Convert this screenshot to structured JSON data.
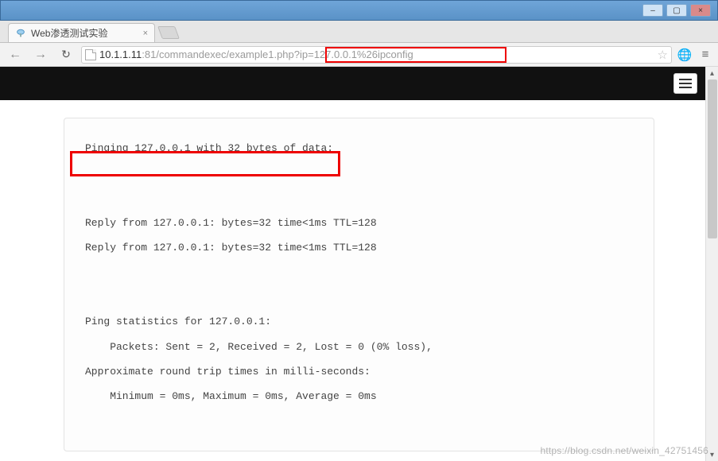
{
  "window": {
    "min_label": "–",
    "max_label": "▢",
    "close_label": "×"
  },
  "tab": {
    "title": "Web渗透测试实验",
    "close": "×"
  },
  "nav": {
    "back": "←",
    "forward": "→",
    "reload": "↻"
  },
  "url": {
    "host": "10.1.1.11",
    "rest": ":81/commandexec/example1.php?ip=127.0.0.1%26ipconfig",
    "star": "☆",
    "globe": "🌐",
    "menu": "≡"
  },
  "hamburger_name": "menu",
  "output": {
    "line1": "Pinging 127.0.0.1 with 32 bytes of data:",
    "line2": "Reply from 127.0.0.1: bytes=32 time<1ms TTL=128",
    "line3": "Reply from 127.0.0.1: bytes=32 time<1ms TTL=128",
    "line4": "Ping statistics for 127.0.0.1:",
    "line5": "    Packets: Sent = 2, Received = 2, Lost = 0 (0% loss),",
    "line6": "Approximate round trip times in milli-seconds:",
    "line7": "    Minimum = 0ms, Maximum = 0ms, Average = 0ms"
  },
  "watermark": "https://blog.csdn.net/weixin_42751456"
}
